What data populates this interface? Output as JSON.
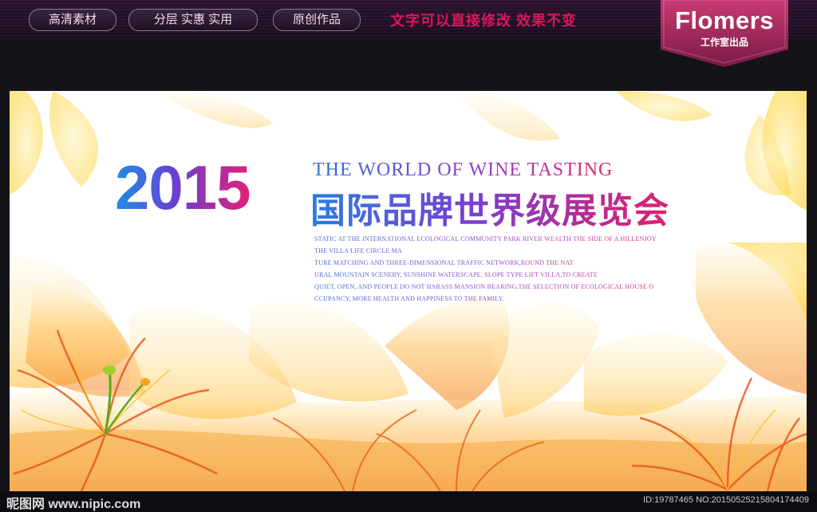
{
  "topbar": {
    "pills": [
      "高清素材",
      "分层 实惠 实用",
      "原创作品"
    ],
    "slogan": "文字可以直接修改  效果不变",
    "logo": {
      "name": "Flomers",
      "subtitle": "工作室出品"
    }
  },
  "poster": {
    "year": "2015",
    "subtitle_en": "THE WORLD OF WINE TASTING",
    "headline_cn": "国际品牌世界级展览会",
    "body_lines": [
      "STATIC AT THE INTERNATIONAL ECOLOGICAL COMMUNITY PARK RIVER WEALTH THE SIDE OF A HILLENJOY",
      "THE VILLA LIFE CIRCLE MA",
      "TURE MATCHING AND THREE-DIMENSIONAL TRAFFIC NETWORK,ROUND THE NAT",
      "URAL MOUNTAIN SCENERY, SUNSHINE WATERSCAPE, SLOPE TYPE LIFT VILLA,TO CREATE",
      "QUIET, OPEN, AND PEOPLE DO NOT HARASS MANSION BEARING.THE SELECTION OF ECOLOGICAL HOUSE O",
      "CCUPANCY, MORE HEALTH AND HAPPINESS TO THE FAMILY."
    ]
  },
  "footer": {
    "watermark_left": "昵图网 www.nipic.com",
    "watermark_right": "ID:19787465 NO:20150525215804174409"
  },
  "colors": {
    "background": "#141318",
    "slogan": "#e0145a",
    "logo_banner": "#a0285a",
    "petal_orange": "#f08a1a",
    "petal_yellow": "#ffd84a"
  }
}
